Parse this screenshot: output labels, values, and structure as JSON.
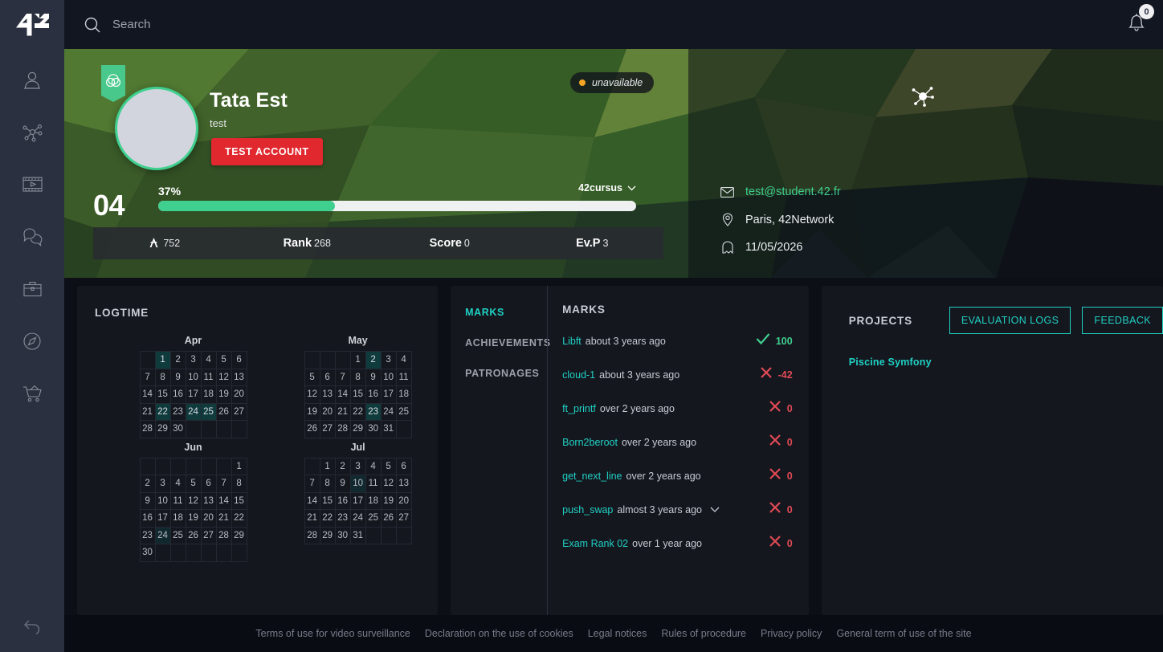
{
  "app": {
    "logo": "42-logo"
  },
  "sidebar": {
    "items": [
      {
        "name": "profile",
        "icon": "person-icon"
      },
      {
        "name": "cluster",
        "icon": "network-icon"
      },
      {
        "name": "media",
        "icon": "film-icon"
      },
      {
        "name": "forum",
        "icon": "chat-bubbles-icon"
      },
      {
        "name": "jobs",
        "icon": "briefcase-icon"
      },
      {
        "name": "explore",
        "icon": "compass-icon"
      },
      {
        "name": "shop",
        "icon": "shopping-cart-icon"
      }
    ],
    "undo": {
      "icon": "undo-arrow-icon"
    }
  },
  "topbar": {
    "search": {
      "placeholder": "Search",
      "value": "",
      "icon": "search-icon"
    },
    "notifications": {
      "icon": "bell-icon",
      "count": "0"
    }
  },
  "profile": {
    "coalition_icon": "coalition-flag-icon",
    "avatar": "user-avatar",
    "name": "Tata Est",
    "login": "test",
    "badge_label": "TEST ACCOUNT",
    "status": {
      "label": "unavailable",
      "dot_color": "#f5a623"
    },
    "cluster_icon": "cluster-map-icon",
    "level": "04",
    "level_percent": "37%",
    "progress_value": 37,
    "cursus": {
      "label": "42cursus",
      "chevron": "chevron-down-icon"
    },
    "stats": [
      {
        "key": "",
        "icon": "wallet-icon",
        "value": "752"
      },
      {
        "key": "Rank",
        "value": "268"
      },
      {
        "key": "Score",
        "value": "0"
      },
      {
        "key": "Ev.P",
        "value": "3"
      }
    ],
    "contact": [
      {
        "icon": "envelope-icon",
        "text": "test@student.42.fr",
        "link": true
      },
      {
        "icon": "location-pin-icon",
        "text": "Paris, 42Network",
        "link": false
      },
      {
        "icon": "ghost-icon",
        "text": "11/05/2026",
        "link": false
      }
    ]
  },
  "logtime": {
    "title": "LOGTIME",
    "months": [
      {
        "name": "Apr",
        "rows": [
          [
            "",
            "1",
            "2",
            "3",
            "4",
            "5",
            "6"
          ],
          [
            "7",
            "8",
            "9",
            "10",
            "11",
            "12",
            "13"
          ],
          [
            "14",
            "15",
            "16",
            "17",
            "18",
            "19",
            "20"
          ],
          [
            "21",
            "22",
            "23",
            "24",
            "25",
            "26",
            "27"
          ],
          [
            "28",
            "29",
            "30",
            "",
            "",
            "",
            ""
          ]
        ],
        "highlights": {
          "1": "h1",
          "22": "h1",
          "24": "h1",
          "25": "h1"
        }
      },
      {
        "name": "May",
        "rows": [
          [
            "",
            "",
            "",
            "1",
            "2",
            "3",
            "4"
          ],
          [
            "5",
            "6",
            "7",
            "8",
            "9",
            "10",
            "11"
          ],
          [
            "12",
            "13",
            "14",
            "15",
            "16",
            "17",
            "18"
          ],
          [
            "19",
            "20",
            "21",
            "22",
            "23",
            "24",
            "25"
          ],
          [
            "26",
            "27",
            "28",
            "29",
            "30",
            "31",
            ""
          ]
        ],
        "highlights": {
          "2": "h1",
          "23": "h1"
        }
      },
      {
        "name": "Jun",
        "rows": [
          [
            "",
            "",
            "",
            "",
            "",
            "",
            "1"
          ],
          [
            "2",
            "3",
            "4",
            "5",
            "6",
            "7",
            "8"
          ],
          [
            "9",
            "10",
            "11",
            "12",
            "13",
            "14",
            "15"
          ],
          [
            "16",
            "17",
            "18",
            "19",
            "20",
            "21",
            "22"
          ],
          [
            "23",
            "24",
            "25",
            "26",
            "27",
            "28",
            "29"
          ],
          [
            "30",
            "",
            "",
            "",
            "",
            "",
            ""
          ]
        ],
        "highlights": {
          "24": "h3"
        }
      },
      {
        "name": "Jul",
        "rows": [
          [
            "",
            "1",
            "2",
            "3",
            "4",
            "5",
            "6"
          ],
          [
            "7",
            "8",
            "9",
            "10",
            "11",
            "12",
            "13"
          ],
          [
            "14",
            "15",
            "16",
            "17",
            "18",
            "19",
            "20"
          ],
          [
            "21",
            "22",
            "23",
            "24",
            "25",
            "26",
            "27"
          ],
          [
            "28",
            "29",
            "30",
            "31",
            "",
            "",
            ""
          ]
        ],
        "highlights": {
          "10": "h3"
        }
      }
    ]
  },
  "marks": {
    "tabs": [
      {
        "label": "MARKS",
        "active": true
      },
      {
        "label": "ACHIEVEMENTS",
        "active": false
      },
      {
        "label": "PATRONAGES",
        "active": false
      }
    ],
    "title": "MARKS",
    "rows": [
      {
        "project": "Libft",
        "when": "about 3 years ago",
        "result": "pass",
        "score": "100",
        "expandable": false
      },
      {
        "project": "cloud-1",
        "when": "about 3 years ago",
        "result": "fail",
        "score": "-42",
        "expandable": false
      },
      {
        "project": "ft_printf",
        "when": "over 2 years ago",
        "result": "fail",
        "score": "0",
        "expandable": false
      },
      {
        "project": "Born2beroot",
        "when": "over 2 years ago",
        "result": "fail",
        "score": "0",
        "expandable": false
      },
      {
        "project": "get_next_line",
        "when": "over 2 years ago",
        "result": "fail",
        "score": "0",
        "expandable": false
      },
      {
        "project": "push_swap",
        "when": "almost 3 years ago",
        "result": "fail",
        "score": "0",
        "expandable": true
      },
      {
        "project": "Exam Rank 02",
        "when": "over 1 year ago",
        "result": "fail",
        "score": "0",
        "expandable": false
      }
    ]
  },
  "projects": {
    "title": "PROJECTS",
    "buttons": [
      {
        "label": "EVALUATION LOGS"
      },
      {
        "label": "FEEDBACK"
      }
    ],
    "items": [
      {
        "label": "Piscine Symfony"
      }
    ]
  },
  "footer": {
    "links": [
      "Terms of use for video surveillance",
      "Declaration on the use of cookies",
      "Legal notices",
      "Rules of procedure",
      "Privacy policy",
      "General term of use of the site"
    ]
  },
  "colors": {
    "accent_green": "#3fcf8e",
    "accent_teal": "#1fd0c3",
    "danger_red": "#e0282e",
    "fail_red": "#e04a54",
    "sidebar_bg": "#2b3040",
    "page_bg": "#0d0f17",
    "panel_bg": "#15171f"
  }
}
